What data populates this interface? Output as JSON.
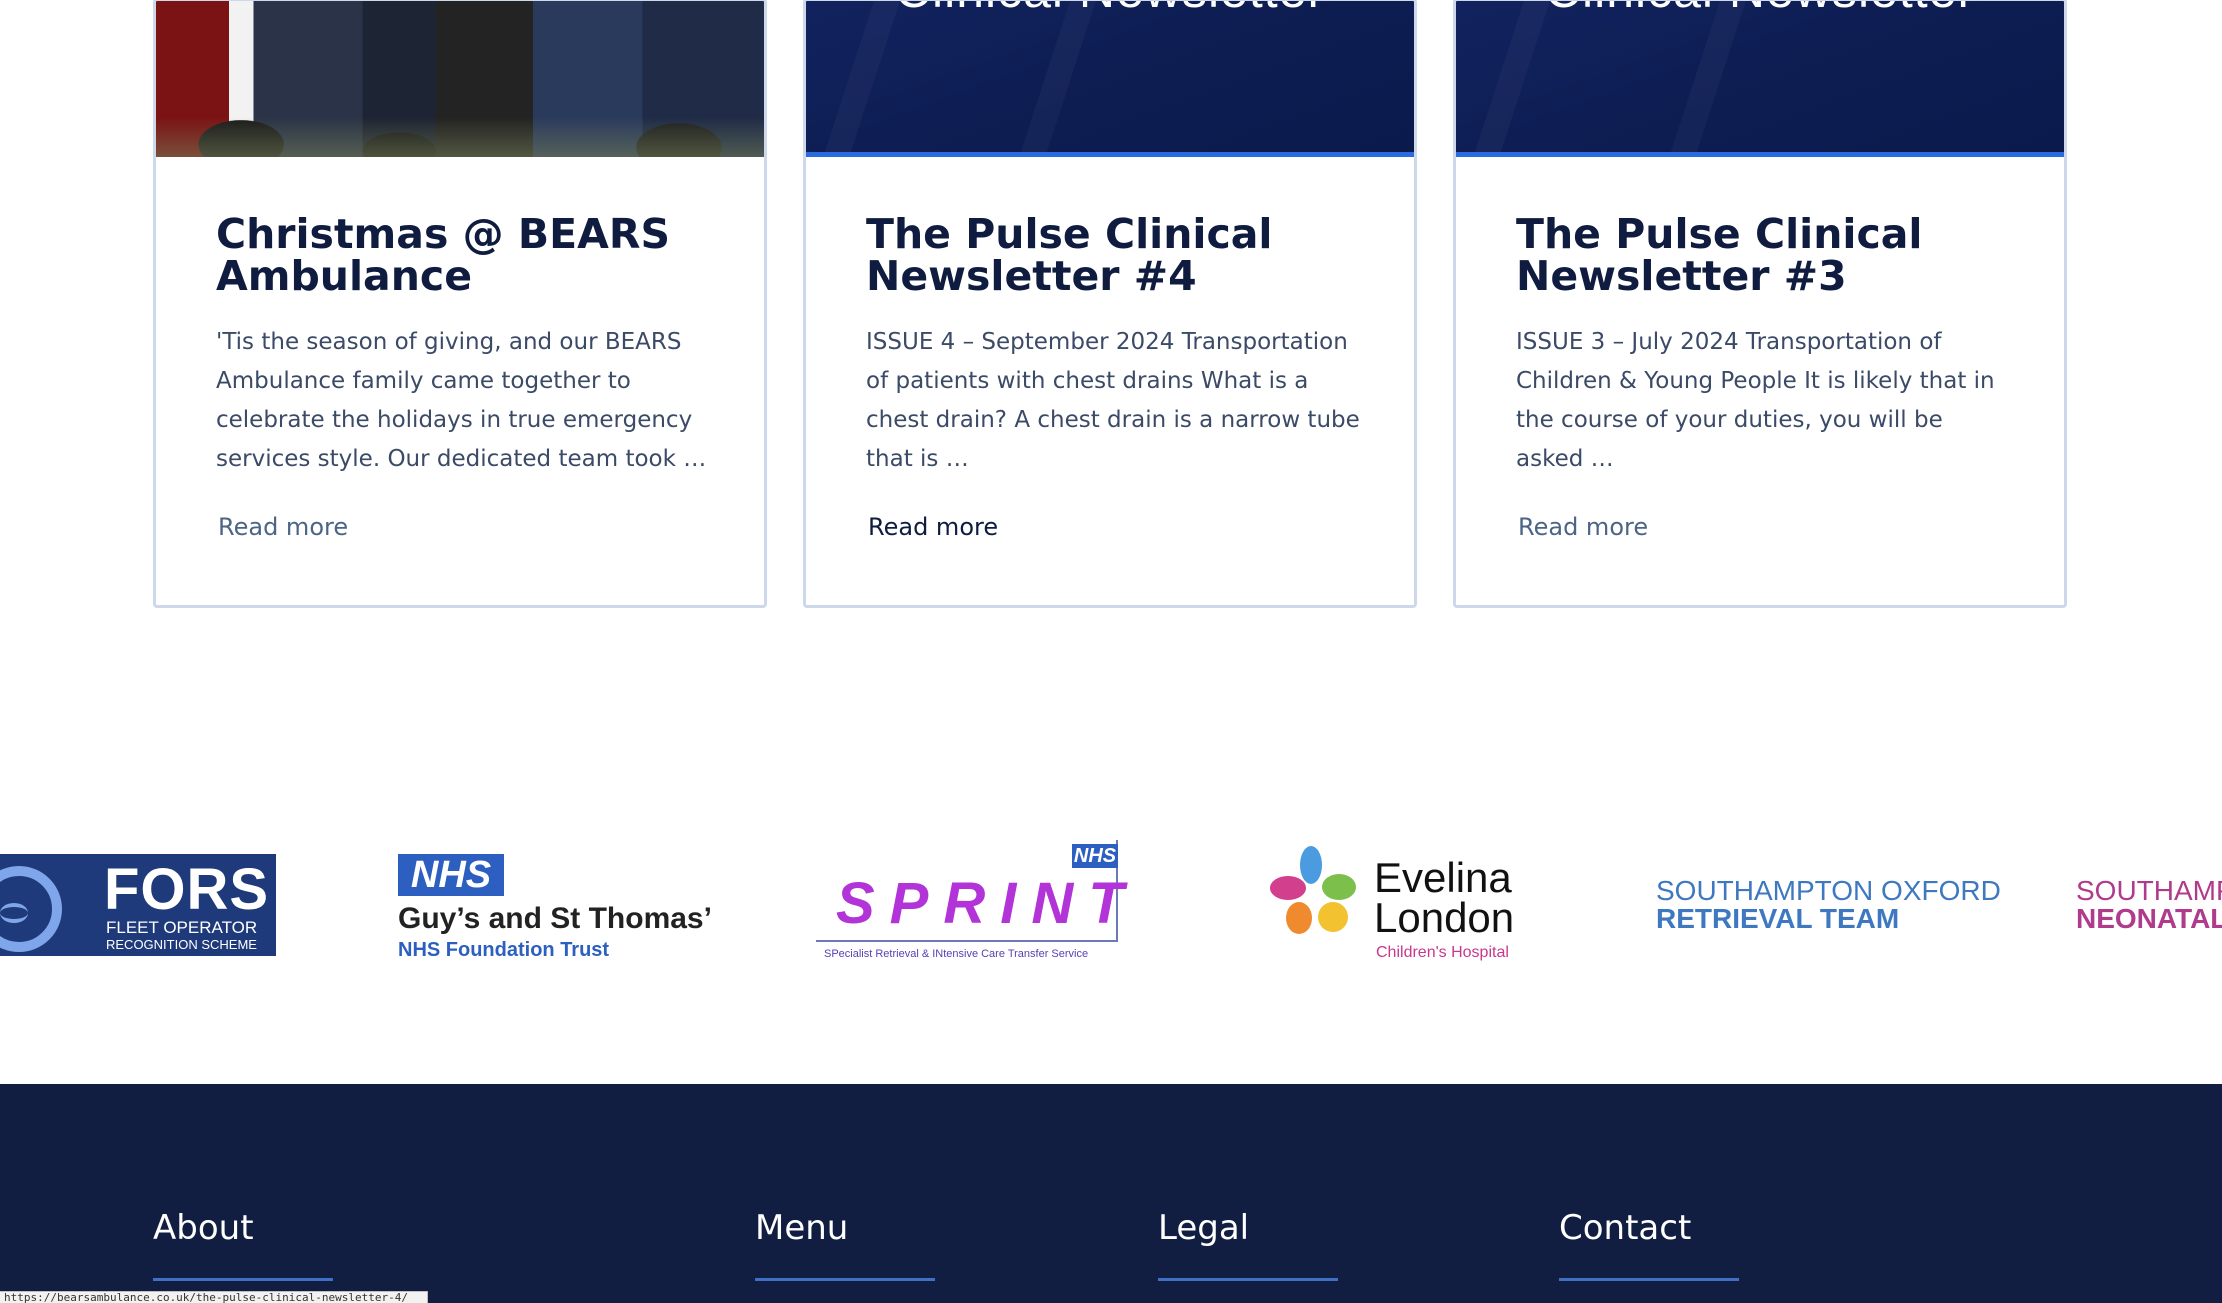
{
  "posts": [
    {
      "title": "Christmas @ BEARS Ambulance",
      "excerpt": "'Tis the season of giving, and our BEARS Ambulance family came together to celebrate the holidays in true emergency services style. Our dedicated team took …",
      "read_more": "Read more"
    },
    {
      "banner_text": "Clinical Newsletter",
      "title": "The Pulse Clinical Newsletter #4",
      "excerpt": "ISSUE 4 – September 2024 Transportation of patients with chest drains What is a chest drain? A chest drain is a narrow tube that is …",
      "read_more": "Read more"
    },
    {
      "banner_text": "Clinical Newsletter",
      "title": "The Pulse Clinical Newsletter #3",
      "excerpt": "ISSUE 3 – July 2024 Transportation of Children & Young People It is likely that in the course of your duties, you will be asked …",
      "read_more": "Read more"
    }
  ],
  "partners": {
    "fors": {
      "word": "FORS",
      "line1": "FLEET OPERATOR",
      "line2": "RECOGNITION SCHEME"
    },
    "gst": {
      "badge": "NHS",
      "name": "Guy’s and St Thomas’",
      "trust": "NHS Foundation Trust"
    },
    "sprint": {
      "badge": "NHS",
      "word": "SPRINT",
      "sub": "SPecialist Retrieval & INtensive Care Transfer Service"
    },
    "evelina": {
      "line1": "Evelina",
      "line2": "London",
      "line3": "Children's Hospital"
    },
    "sort": {
      "line1": "SOUTHAMPTON OXFORD",
      "line2": "RETRIEVAL TEAM"
    },
    "neonatal": {
      "line1": "SOUTHAMPTON",
      "line2": "NEONATAL"
    }
  },
  "footer": {
    "about": "About",
    "menu": "Menu",
    "legal": "Legal",
    "contact": "Contact"
  },
  "status_url": "https://bearsambulance.co.uk/the-pulse-clinical-newsletter-4/",
  "colors": {
    "navy": "#111e42",
    "accent_blue": "#2b6be0",
    "card_border": "#cdd9ea",
    "title": "#0f1c3f"
  },
  "icons": [
    "fors-wheel-icon",
    "nhs-logo-icon",
    "evelina-petals-icon"
  ]
}
